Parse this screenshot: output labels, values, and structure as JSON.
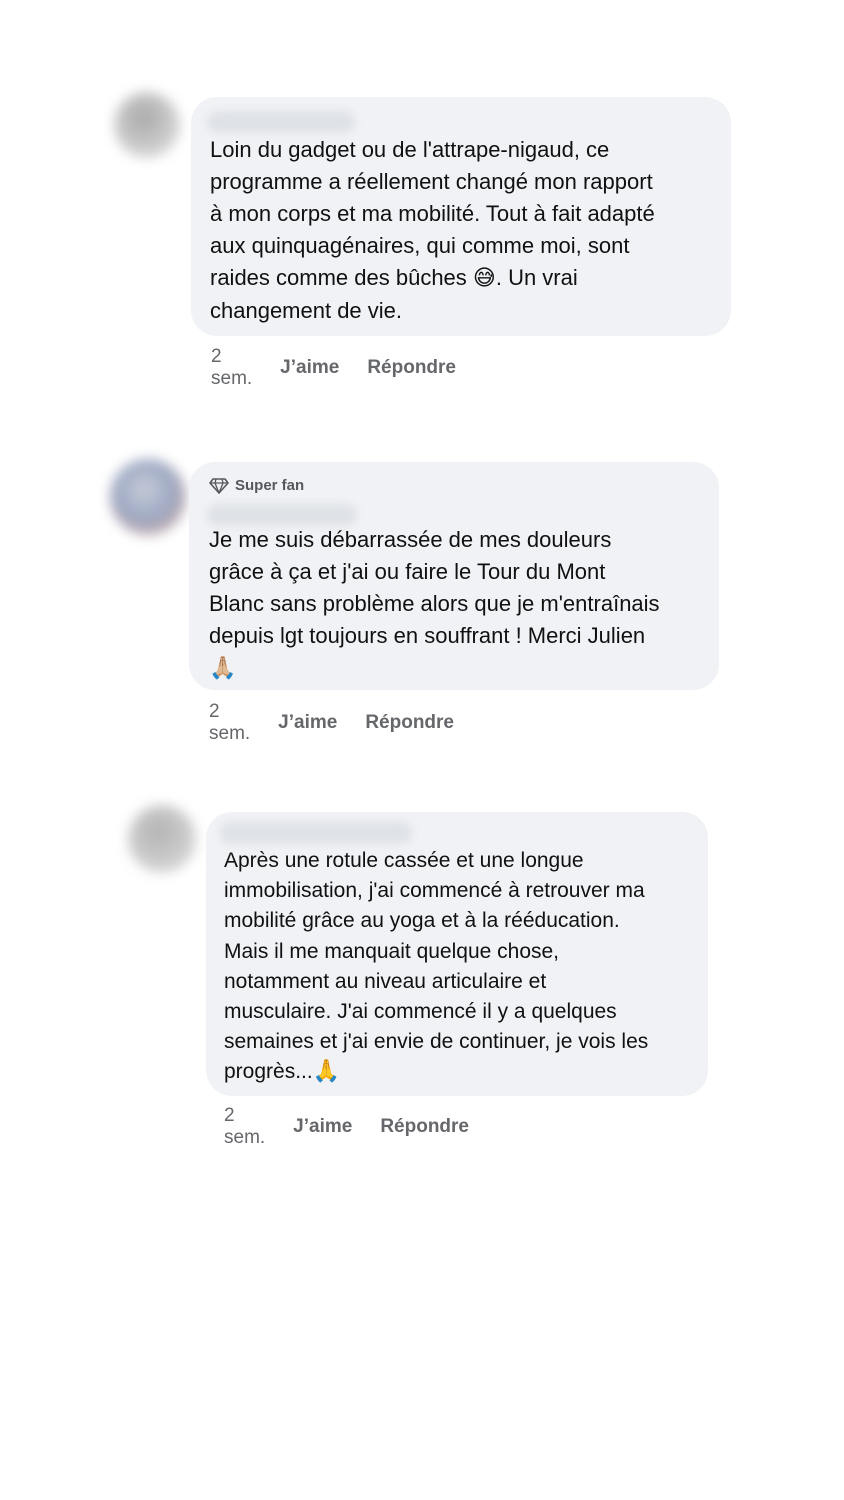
{
  "comments": [
    {
      "badge": "",
      "text": "Loin du gadget ou de l'attrape-nigaud, ce\nprogramme a réellement changé mon rapport\nà mon corps et ma mobilité. Tout à fait adapté\naux quinquagénaires, qui comme moi, sont\nraides comme des bûches ",
      "emoji": "😅",
      "text_after": ". Un vrai\nchangement de vie.",
      "time": "2 sem.",
      "like_label": "J’aime",
      "reply_label": "Répondre"
    },
    {
      "badge": "Super fan",
      "badge_icon": "diamond-icon",
      "text": "Je me suis débarrassée de mes douleurs\ngrâce à ça et j'ai ou faire le Tour du Mont\nBlanc sans problème alors que je m'entraînais\ndepuis lgt toujours en souffrant ! Merci Julien\n",
      "emoji": "🙏🏼",
      "text_after": "",
      "time": "2 sem.",
      "like_label": "J’aime",
      "reply_label": "Répondre"
    },
    {
      "badge": "",
      "text": "Après une rotule cassée et une longue\nimmobilisation, j'ai commencé à retrouver ma\nmobilité grâce au yoga et à la rééducation.\nMais il me manquait quelque chose,\nnotamment au niveau articulaire et\nmusculaire. J'ai commencé il y a quelques\nsemaines et j'ai envie de continuer, je vois les\nprogrès...",
      "emoji": "🙏",
      "text_after": "",
      "time": "2 sem.",
      "like_label": "J’aime",
      "reply_label": "Répondre"
    }
  ],
  "colors": {
    "bubble_bg": "#f0f2f5",
    "meta_text": "#65676b",
    "body_text": "#111111"
  }
}
